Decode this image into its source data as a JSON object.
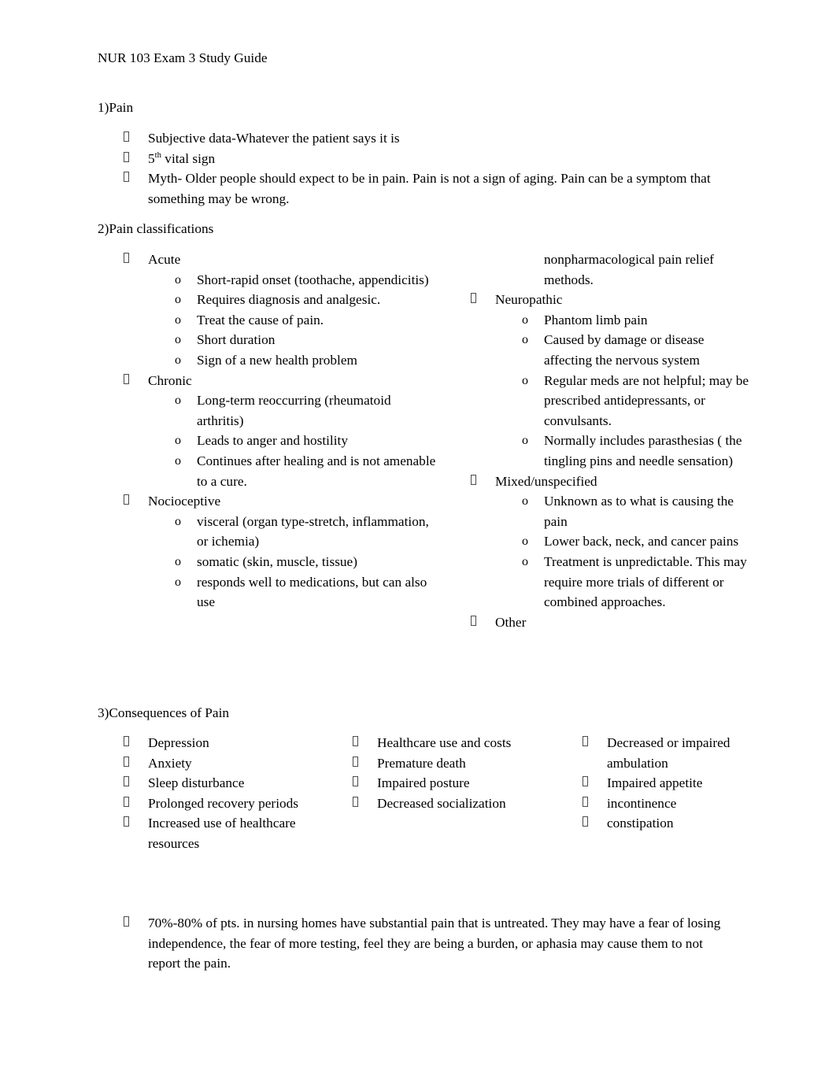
{
  "document": {
    "title": "NUR 103 Exam 3 Study Guide",
    "bullet_glyph": "missing-glyph-box"
  },
  "section1": {
    "heading": "1)Pain",
    "items": [
      {
        "text": "Subjective data-Whatever the patient says it is"
      },
      {
        "text_prefix": "5",
        "superscript": "th",
        "text_suffix": " vital sign"
      },
      {
        "text": "Myth- Older people should expect to be in pain. Pain is not a sign of aging. Pain can be a symptom that something may be wrong."
      }
    ]
  },
  "section2": {
    "heading": "2)Pain classifications",
    "left_column": [
      {
        "level": 1,
        "text": "Acute"
      },
      {
        "level": 2,
        "text": "Short-rapid onset (toothache, appendicitis)"
      },
      {
        "level": 2,
        "text": "Requires diagnosis and analgesic."
      },
      {
        "level": 2,
        "text": "Treat the cause of pain."
      },
      {
        "level": 2,
        "text": "Short duration"
      },
      {
        "level": 2,
        "text": "Sign of a new health problem"
      },
      {
        "level": 1,
        "text": "Chronic"
      },
      {
        "level": 2,
        "text": "Long-term reoccurring (rheumatoid arthritis)"
      },
      {
        "level": 2,
        "text": "Leads to anger and hostility"
      },
      {
        "level": 2,
        "text": "Continues after healing and is not amenable to a cure."
      },
      {
        "level": 1,
        "text": "Nocioceptive"
      },
      {
        "level": 2,
        "text": "visceral (organ type-stretch, inflammation, or ichemia)"
      },
      {
        "level": 2,
        "text": "somatic (skin, muscle, tissue)"
      },
      {
        "level": 2,
        "text": "responds well to medications, but can also use"
      }
    ],
    "right_column": [
      {
        "level": 2,
        "continuation": true,
        "text": "nonpharmacological pain relief methods."
      },
      {
        "level": 1,
        "text": "Neuropathic"
      },
      {
        "level": 2,
        "text": "Phantom limb pain"
      },
      {
        "level": 2,
        "text": "Caused by damage or disease affecting the nervous system"
      },
      {
        "level": 2,
        "text": "Regular meds are not helpful; may be prescribed antidepressants, or convulsants."
      },
      {
        "level": 2,
        "text": "Normally includes parasthesias ( the tingling pins and needle sensation)"
      },
      {
        "level": 1,
        "text": "Mixed/unspecified"
      },
      {
        "level": 2,
        "text": "Unknown as to what is causing the pain"
      },
      {
        "level": 2,
        "text": "Lower back, neck, and cancer pains"
      },
      {
        "level": 2,
        "text": "Treatment is unpredictable. This may require more trials of different or combined approaches."
      },
      {
        "level": 1,
        "text": "Other"
      }
    ]
  },
  "section3": {
    "heading": "3)Consequences of Pain",
    "column1": [
      {
        "text": "Depression"
      },
      {
        "text": "Anxiety"
      },
      {
        "text": "Sleep disturbance"
      },
      {
        "text": "Prolonged recovery periods"
      },
      {
        "text": "Increased use of healthcare resources"
      }
    ],
    "column2": [
      {
        "text": "Healthcare use and costs"
      },
      {
        "text": "Premature death"
      },
      {
        "text": "Impaired posture"
      },
      {
        "text": "Decreased socialization"
      }
    ],
    "column3": [
      {
        "text": "Decreased or impaired ambulation"
      },
      {
        "text": "Impaired appetite"
      },
      {
        "text": "incontinence"
      },
      {
        "text": "constipation"
      }
    ]
  },
  "final_note": {
    "text": "70%-80% of pts. in nursing homes have substantial pain that is untreated. They may have a fear of losing independence, the fear of more testing, feel they are being a burden, or aphasia may cause them to not report the pain."
  }
}
